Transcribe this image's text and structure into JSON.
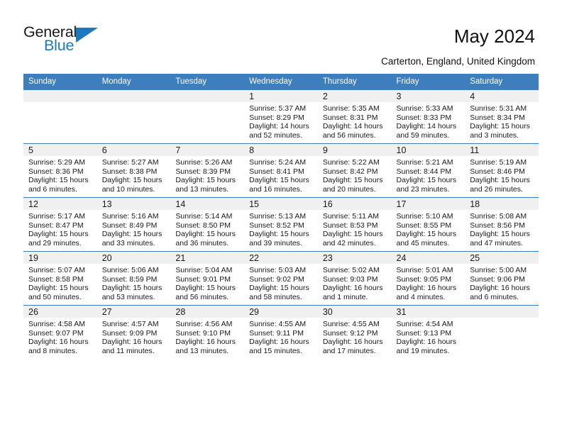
{
  "brand": {
    "name_part1": "General",
    "name_part2": "Blue",
    "color_primary": "#1c79c0",
    "color_text": "#1a1a1a",
    "triangle_icon": "triangle-right-icon"
  },
  "header": {
    "title": "May 2024",
    "location": "Carterton, England, United Kingdom"
  },
  "calendar": {
    "header_bg": "#3d7ebe",
    "daynum_bg": "#f0f0f0",
    "weekdays": [
      "Sunday",
      "Monday",
      "Tuesday",
      "Wednesday",
      "Thursday",
      "Friday",
      "Saturday"
    ],
    "weeks": [
      [
        {
          "day": "",
          "sunrise": "",
          "sunset": "",
          "daylight1": "",
          "daylight2": ""
        },
        {
          "day": "",
          "sunrise": "",
          "sunset": "",
          "daylight1": "",
          "daylight2": ""
        },
        {
          "day": "",
          "sunrise": "",
          "sunset": "",
          "daylight1": "",
          "daylight2": ""
        },
        {
          "day": "1",
          "sunrise": "Sunrise: 5:37 AM",
          "sunset": "Sunset: 8:29 PM",
          "daylight1": "Daylight: 14 hours",
          "daylight2": "and 52 minutes."
        },
        {
          "day": "2",
          "sunrise": "Sunrise: 5:35 AM",
          "sunset": "Sunset: 8:31 PM",
          "daylight1": "Daylight: 14 hours",
          "daylight2": "and 56 minutes."
        },
        {
          "day": "3",
          "sunrise": "Sunrise: 5:33 AM",
          "sunset": "Sunset: 8:33 PM",
          "daylight1": "Daylight: 14 hours",
          "daylight2": "and 59 minutes."
        },
        {
          "day": "4",
          "sunrise": "Sunrise: 5:31 AM",
          "sunset": "Sunset: 8:34 PM",
          "daylight1": "Daylight: 15 hours",
          "daylight2": "and 3 minutes."
        }
      ],
      [
        {
          "day": "5",
          "sunrise": "Sunrise: 5:29 AM",
          "sunset": "Sunset: 8:36 PM",
          "daylight1": "Daylight: 15 hours",
          "daylight2": "and 6 minutes."
        },
        {
          "day": "6",
          "sunrise": "Sunrise: 5:27 AM",
          "sunset": "Sunset: 8:38 PM",
          "daylight1": "Daylight: 15 hours",
          "daylight2": "and 10 minutes."
        },
        {
          "day": "7",
          "sunrise": "Sunrise: 5:26 AM",
          "sunset": "Sunset: 8:39 PM",
          "daylight1": "Daylight: 15 hours",
          "daylight2": "and 13 minutes."
        },
        {
          "day": "8",
          "sunrise": "Sunrise: 5:24 AM",
          "sunset": "Sunset: 8:41 PM",
          "daylight1": "Daylight: 15 hours",
          "daylight2": "and 16 minutes."
        },
        {
          "day": "9",
          "sunrise": "Sunrise: 5:22 AM",
          "sunset": "Sunset: 8:42 PM",
          "daylight1": "Daylight: 15 hours",
          "daylight2": "and 20 minutes."
        },
        {
          "day": "10",
          "sunrise": "Sunrise: 5:21 AM",
          "sunset": "Sunset: 8:44 PM",
          "daylight1": "Daylight: 15 hours",
          "daylight2": "and 23 minutes."
        },
        {
          "day": "11",
          "sunrise": "Sunrise: 5:19 AM",
          "sunset": "Sunset: 8:46 PM",
          "daylight1": "Daylight: 15 hours",
          "daylight2": "and 26 minutes."
        }
      ],
      [
        {
          "day": "12",
          "sunrise": "Sunrise: 5:17 AM",
          "sunset": "Sunset: 8:47 PM",
          "daylight1": "Daylight: 15 hours",
          "daylight2": "and 29 minutes."
        },
        {
          "day": "13",
          "sunrise": "Sunrise: 5:16 AM",
          "sunset": "Sunset: 8:49 PM",
          "daylight1": "Daylight: 15 hours",
          "daylight2": "and 33 minutes."
        },
        {
          "day": "14",
          "sunrise": "Sunrise: 5:14 AM",
          "sunset": "Sunset: 8:50 PM",
          "daylight1": "Daylight: 15 hours",
          "daylight2": "and 36 minutes."
        },
        {
          "day": "15",
          "sunrise": "Sunrise: 5:13 AM",
          "sunset": "Sunset: 8:52 PM",
          "daylight1": "Daylight: 15 hours",
          "daylight2": "and 39 minutes."
        },
        {
          "day": "16",
          "sunrise": "Sunrise: 5:11 AM",
          "sunset": "Sunset: 8:53 PM",
          "daylight1": "Daylight: 15 hours",
          "daylight2": "and 42 minutes."
        },
        {
          "day": "17",
          "sunrise": "Sunrise: 5:10 AM",
          "sunset": "Sunset: 8:55 PM",
          "daylight1": "Daylight: 15 hours",
          "daylight2": "and 45 minutes."
        },
        {
          "day": "18",
          "sunrise": "Sunrise: 5:08 AM",
          "sunset": "Sunset: 8:56 PM",
          "daylight1": "Daylight: 15 hours",
          "daylight2": "and 47 minutes."
        }
      ],
      [
        {
          "day": "19",
          "sunrise": "Sunrise: 5:07 AM",
          "sunset": "Sunset: 8:58 PM",
          "daylight1": "Daylight: 15 hours",
          "daylight2": "and 50 minutes."
        },
        {
          "day": "20",
          "sunrise": "Sunrise: 5:06 AM",
          "sunset": "Sunset: 8:59 PM",
          "daylight1": "Daylight: 15 hours",
          "daylight2": "and 53 minutes."
        },
        {
          "day": "21",
          "sunrise": "Sunrise: 5:04 AM",
          "sunset": "Sunset: 9:01 PM",
          "daylight1": "Daylight: 15 hours",
          "daylight2": "and 56 minutes."
        },
        {
          "day": "22",
          "sunrise": "Sunrise: 5:03 AM",
          "sunset": "Sunset: 9:02 PM",
          "daylight1": "Daylight: 15 hours",
          "daylight2": "and 58 minutes."
        },
        {
          "day": "23",
          "sunrise": "Sunrise: 5:02 AM",
          "sunset": "Sunset: 9:03 PM",
          "daylight1": "Daylight: 16 hours",
          "daylight2": "and 1 minute."
        },
        {
          "day": "24",
          "sunrise": "Sunrise: 5:01 AM",
          "sunset": "Sunset: 9:05 PM",
          "daylight1": "Daylight: 16 hours",
          "daylight2": "and 4 minutes."
        },
        {
          "day": "25",
          "sunrise": "Sunrise: 5:00 AM",
          "sunset": "Sunset: 9:06 PM",
          "daylight1": "Daylight: 16 hours",
          "daylight2": "and 6 minutes."
        }
      ],
      [
        {
          "day": "26",
          "sunrise": "Sunrise: 4:58 AM",
          "sunset": "Sunset: 9:07 PM",
          "daylight1": "Daylight: 16 hours",
          "daylight2": "and 8 minutes."
        },
        {
          "day": "27",
          "sunrise": "Sunrise: 4:57 AM",
          "sunset": "Sunset: 9:09 PM",
          "daylight1": "Daylight: 16 hours",
          "daylight2": "and 11 minutes."
        },
        {
          "day": "28",
          "sunrise": "Sunrise: 4:56 AM",
          "sunset": "Sunset: 9:10 PM",
          "daylight1": "Daylight: 16 hours",
          "daylight2": "and 13 minutes."
        },
        {
          "day": "29",
          "sunrise": "Sunrise: 4:55 AM",
          "sunset": "Sunset: 9:11 PM",
          "daylight1": "Daylight: 16 hours",
          "daylight2": "and 15 minutes."
        },
        {
          "day": "30",
          "sunrise": "Sunrise: 4:55 AM",
          "sunset": "Sunset: 9:12 PM",
          "daylight1": "Daylight: 16 hours",
          "daylight2": "and 17 minutes."
        },
        {
          "day": "31",
          "sunrise": "Sunrise: 4:54 AM",
          "sunset": "Sunset: 9:13 PM",
          "daylight1": "Daylight: 16 hours",
          "daylight2": "and 19 minutes."
        },
        {
          "day": "",
          "sunrise": "",
          "sunset": "",
          "daylight1": "",
          "daylight2": ""
        }
      ]
    ]
  }
}
